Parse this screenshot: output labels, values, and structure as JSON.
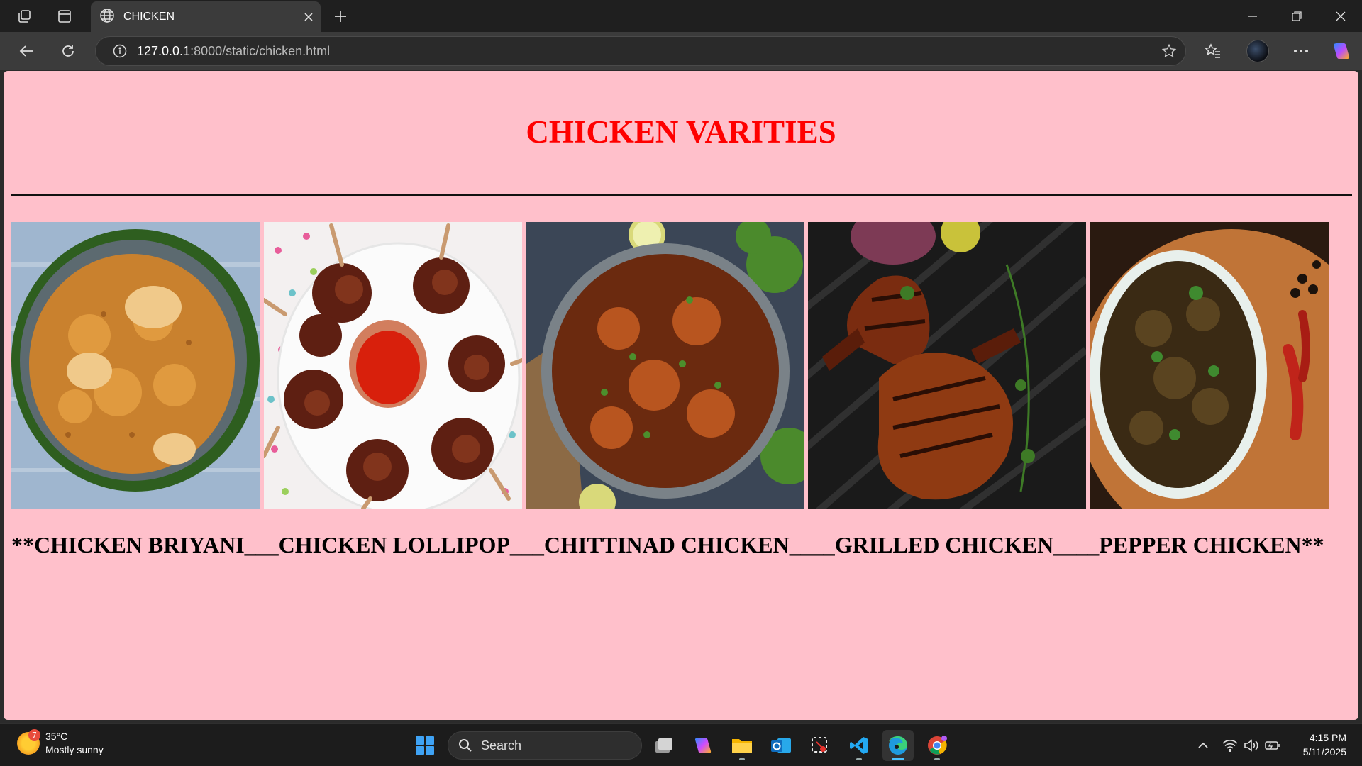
{
  "browser": {
    "tab_title": "CHICKEN",
    "url_host": "127.0.0.1",
    "url_path": ":8000/static/chicken.html"
  },
  "page": {
    "heading": "CHICKEN VARITIES",
    "caption": "**CHICKEN BRIYANI___CHICKEN LOLLIPOP___CHITTINAD CHICKEN____GRILLED CHICKEN____PEPPER CHICKEN**",
    "images": [
      {
        "name": "chicken-briyani-image",
        "depicts": "chicken biryani in steel pot on banana leaf"
      },
      {
        "name": "chicken-lollipop-image",
        "depicts": "fried chicken lollipops around red sauce bowl"
      },
      {
        "name": "chittinad-chicken-image",
        "depicts": "chicken curry in grey bowl"
      },
      {
        "name": "grilled-chicken-image",
        "depicts": "grilled chicken legs on grill pan"
      },
      {
        "name": "pepper-chicken-image",
        "depicts": "pepper chicken in white bowl"
      }
    ]
  },
  "taskbar": {
    "weather_temp": "35°C",
    "weather_desc": "Mostly sunny",
    "weather_badge": "7",
    "search_label": "Search",
    "time": "4:15 PM",
    "date": "5/11/2025"
  },
  "colors": {
    "page_bg": "#ffc0cb",
    "heading": "#ff0000"
  }
}
